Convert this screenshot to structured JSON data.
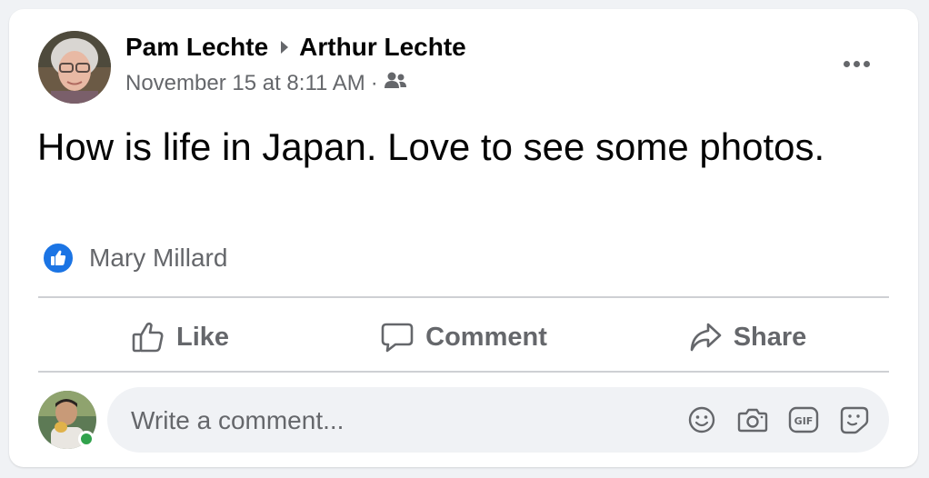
{
  "post": {
    "author": "Pam Lechte",
    "recipient": "Arthur Lechte",
    "timestamp": "November 15 at 8:11 AM",
    "separator": "·",
    "audience_icon": "friends-icon",
    "text": "How is life in Japan. Love to see some photos."
  },
  "reactions": {
    "type": "like",
    "names": "Mary Millard"
  },
  "actions": {
    "like_label": "Like",
    "comment_label": "Comment",
    "share_label": "Share"
  },
  "composer": {
    "placeholder": "Write a comment...",
    "icons": [
      "emoji-icon",
      "camera-icon",
      "gif-icon",
      "sticker-icon"
    ]
  },
  "colors": {
    "accent": "#1b74e4",
    "text_primary": "#050505",
    "text_secondary": "#65676b",
    "divider": "#ced0d4",
    "input_bg": "#f0f2f5",
    "online": "#31a24c"
  }
}
